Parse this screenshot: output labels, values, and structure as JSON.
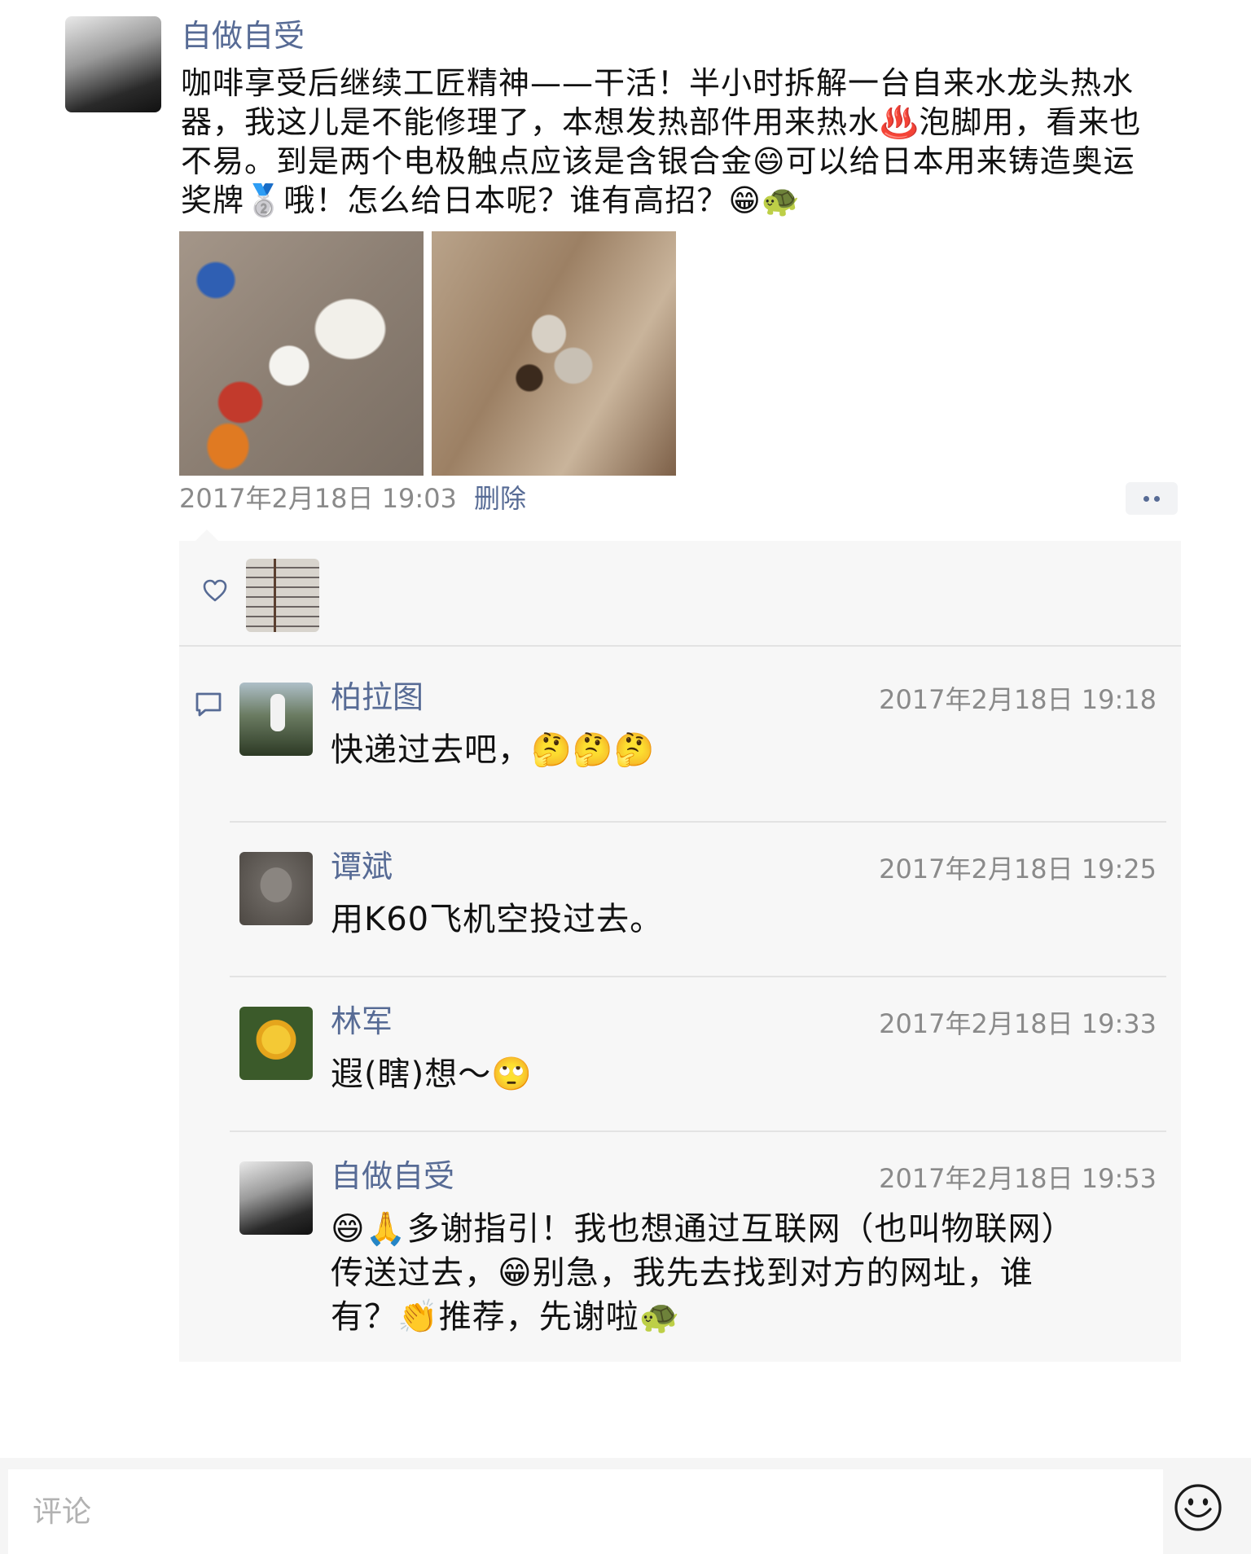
{
  "post": {
    "author": "自做自受",
    "body_lines": [
      "咖啡享受后继续工匠精神——干活！半小时拆解一台自来水龙头热水",
      "器，我这儿是不能修理了，本想发热部件用来热水♨️泡脚用，看来也",
      "不易。到是两个电极触点应该是含银合金😄可以给日本用来铸造奥运",
      "奖牌🥈哦！怎么给日本呢？谁有高招？😁🐢"
    ],
    "time": "2017年2月18日 19:03",
    "delete_label": "删除"
  },
  "comments": [
    {
      "name": "柏拉图",
      "time": "2017年2月18日 19:18",
      "lines": [
        "快递过去吧，🤔🤔🤔"
      ]
    },
    {
      "name": "谭斌",
      "time": "2017年2月18日 19:25",
      "lines": [
        "用K60飞机空投过去。"
      ]
    },
    {
      "name": "林军",
      "time": "2017年2月18日 19:33",
      "lines": [
        "遐(瞎)想～🙄"
      ]
    },
    {
      "name": "自做自受",
      "time": "2017年2月18日 19:53",
      "lines": [
        "😄🙏多谢指引！我也想通过互联网（也叫物联网）",
        "传送过去，😁别急，我先去找到对方的网址，谁",
        "有？👏推荐，先谢啦🐢"
      ]
    }
  ],
  "comment_input": {
    "placeholder": "评论"
  },
  "icons": {
    "like": "heart-icon",
    "comment": "comment-icon",
    "more": "more-dots-icon",
    "emoji": "emoji-face-icon"
  },
  "colors": {
    "link": "#576b95",
    "timestamp": "#8a8a8a",
    "panel_bg": "#f7f7f7"
  }
}
